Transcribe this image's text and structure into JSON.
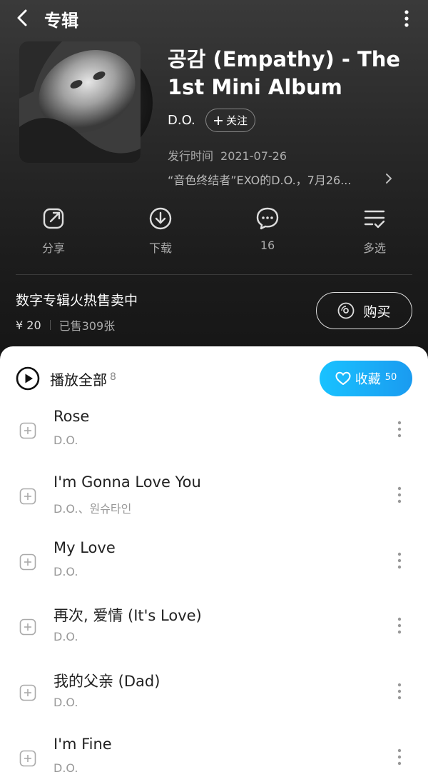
{
  "header": {
    "title": "专辑",
    "back_icon": "back-arrow-icon",
    "more_icon": "more-vertical-icon"
  },
  "album": {
    "title": "공감 (Empathy) - The 1st Mini Album",
    "artist": "D.O.",
    "follow_label": "关注",
    "release_label": "发行时间",
    "release_date": "2021-07-26",
    "description": "“音色终结者”EXO的D.O.，7月26..."
  },
  "actions": [
    {
      "label": "分享",
      "icon": "share-icon"
    },
    {
      "label": "下载",
      "icon": "download-icon"
    },
    {
      "label": "16",
      "icon": "comment-icon"
    },
    {
      "label": "多选",
      "icon": "multi-select-icon"
    }
  ],
  "promo": {
    "title": "数字专辑火热售卖中",
    "price": "¥ 20",
    "sold": "已售309张",
    "buy_label": "购买"
  },
  "list": {
    "play_all_label": "播放全部",
    "track_count": "8",
    "favorite_label": "收藏",
    "favorite_count": "50"
  },
  "tracks": [
    {
      "name": "Rose",
      "artist": "D.O."
    },
    {
      "name": "I'm Gonna Love You",
      "artist": "D.O.、원슈타인"
    },
    {
      "name": "My Love",
      "artist": "D.O."
    },
    {
      "name": "再次, 爱情 (It's Love)",
      "artist": "D.O."
    },
    {
      "name": "我的父亲 (Dad)",
      "artist": "D.O."
    },
    {
      "name": "I'm Fine",
      "artist": "D.O."
    }
  ],
  "colors": {
    "accent_start": "#19c2ff",
    "accent_end": "#1a9bf0",
    "header_bg": "#2a2a2a"
  }
}
